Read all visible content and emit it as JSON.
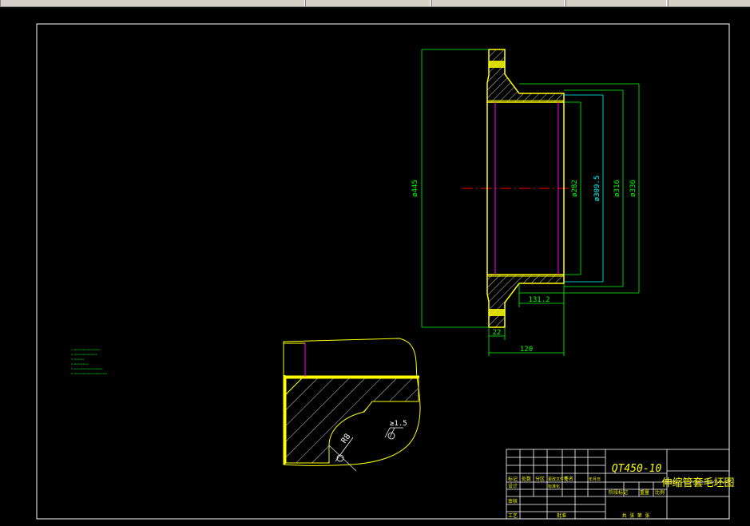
{
  "window": {
    "taskbar_items": [
      "",
      "",
      "",
      "",
      "",
      ""
    ]
  },
  "drawing": {
    "dimensions": {
      "outer_dia": "ø445",
      "d282": "ø282",
      "d3095": "ø309.5",
      "d316": "ø316",
      "d336": "ø336",
      "len_1312": "131.2",
      "len_22": "22",
      "len_120": "120"
    },
    "detail": {
      "radius_label": "R8",
      "slope_label": "≥1.5"
    },
    "notes": [
      "1.xxxxxxxxxxxxxxxxxx",
      "2.xxxxxxxxxxxxxxxx",
      "3.xxxxxxx",
      "4.xxxxxxxxxx",
      "5.xxxxxxxxxxxxxxxxxxxx",
      "6.xxxxxxxxxxxxxxxxxxxxxxx"
    ],
    "title_block": {
      "material": "QT450-10",
      "part_name": "伸缩管套毛坯图",
      "labels": {
        "mark": "标记",
        "count": "处数",
        "zone": "分区",
        "change_doc": "更改文件号",
        "signature": "签名",
        "date": "年月日",
        "design": "设计",
        "standardize": "标准化",
        "stage_mark": "阶段标记",
        "weight": "重量",
        "scale": "比例",
        "review": "审核",
        "process": "工艺",
        "approve": "批准",
        "sheets": "共 张 第 张"
      }
    }
  },
  "colors": {
    "background": "#000000",
    "frame": "#ffffff",
    "part_outline": "#ffff00",
    "dimension": "#00ff00",
    "dimension_alt": "#00ffff",
    "center_line": "#ff0000",
    "inner_edge": "#ff00ff",
    "hatch": "#ffffff",
    "notes": "#00ff00",
    "title_text": "#ffff00",
    "title_material": "#ffff00"
  }
}
